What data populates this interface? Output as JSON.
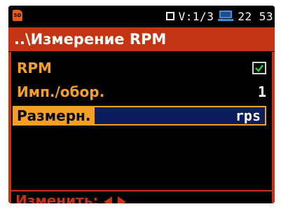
{
  "status_bar": {
    "sd_icon": "SD",
    "measure_label": "V:1/3",
    "time": "22 53"
  },
  "title": "..\\Измерение RPM",
  "rows": [
    {
      "label": "RPM",
      "checked": true
    },
    {
      "label": "Имп./обор.",
      "value": "1"
    },
    {
      "label": "Размерн.",
      "value": "rps"
    }
  ],
  "footer": {
    "label": "Изменить:"
  },
  "colors": {
    "title_bg": "#c23412",
    "label": "#f4a028",
    "selected_value_bg": "#0b1d5c"
  }
}
